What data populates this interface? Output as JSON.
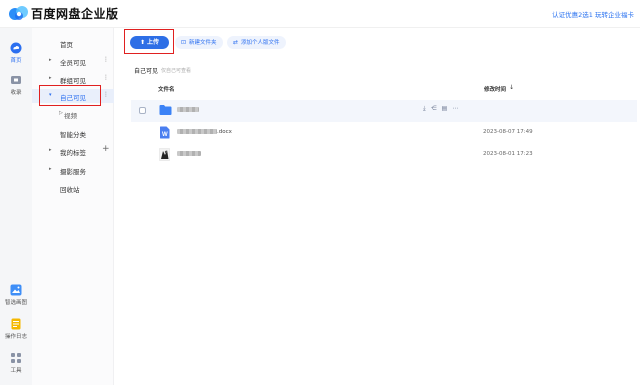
{
  "header": {
    "brand": "百度网盘企业版",
    "right_link": "认证优惠2选1 玩转企业福卡"
  },
  "rail": {
    "items": [
      {
        "label": "首页",
        "icon": "cloud-home-icon",
        "color": "#2b6ff0"
      },
      {
        "label": "收录",
        "icon": "collect-icon",
        "color": "#8a93a6"
      },
      {
        "label": "智选画图",
        "icon": "image-ai-icon",
        "color": "#3e8ef7"
      },
      {
        "label": "操作日志",
        "icon": "log-icon",
        "color": "#f5b800"
      },
      {
        "label": "工具",
        "icon": "tools-grid-icon",
        "color": "#8a93a6"
      }
    ]
  },
  "nav": {
    "items": [
      {
        "label": "首页",
        "arrow": "",
        "extra": ""
      },
      {
        "label": "全员可见",
        "arrow": "▸",
        "extra": "⋮"
      },
      {
        "label": "群组可见",
        "arrow": "▸",
        "extra": "⋮"
      },
      {
        "label": "自己可见",
        "arrow": "▾",
        "extra": "⋮"
      },
      {
        "label": "视频",
        "arrow": "▷",
        "extra": ""
      },
      {
        "label": "智能分类",
        "arrow": "",
        "extra": ""
      },
      {
        "label": "我的标签",
        "arrow": "▸",
        "extra": "+"
      },
      {
        "label": "摄影服务",
        "arrow": "▸",
        "extra": ""
      },
      {
        "label": "回收站",
        "arrow": "",
        "extra": ""
      }
    ]
  },
  "toolbar": {
    "upload_label": "上传",
    "upload_icon": "upload-icon",
    "new_folder_label": "新建文件夹",
    "new_folder_icon": "new-folder-icon",
    "add_personal_label": "添加个人版文件",
    "add_personal_icon": "transfer-icon"
  },
  "breadcrumb": {
    "title": "自己可见",
    "subtitle": "仅自己可查看"
  },
  "table": {
    "col_name": "文件名",
    "col_time": "修改时间",
    "sort_icon": "↓",
    "rows": [
      {
        "type": "folder",
        "name_suffix": "",
        "time": "",
        "icon": "folder-icon"
      },
      {
        "type": "doc",
        "name_suffix": ".docx",
        "time": "2023-08-07 17:49",
        "icon": "word-doc-icon"
      },
      {
        "type": "image",
        "name_suffix": "",
        "time": "2023-08-01 17:23",
        "icon": "image-thumb-icon"
      }
    ],
    "row_actions": [
      "download-icon",
      "share-icon",
      "copy-link-icon",
      "more-icon"
    ]
  },
  "colors": {
    "accent": "#2b6ff0",
    "upload_bg": "#2e6fe6",
    "highlight_red": "#e02020"
  }
}
